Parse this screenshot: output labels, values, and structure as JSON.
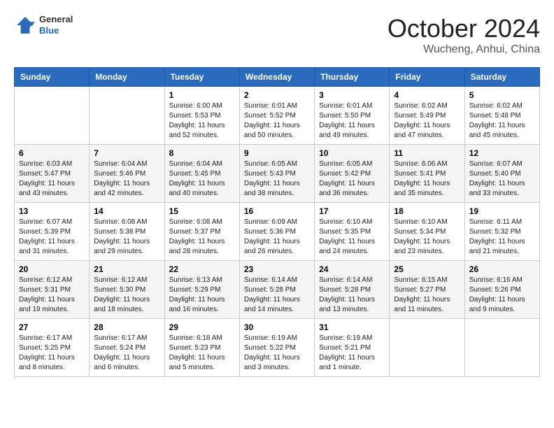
{
  "header": {
    "logo": {
      "general": "General",
      "blue": "Blue"
    },
    "title": "October 2024",
    "location": "Wucheng, Anhui, China"
  },
  "weekdays": [
    "Sunday",
    "Monday",
    "Tuesday",
    "Wednesday",
    "Thursday",
    "Friday",
    "Saturday"
  ],
  "weeks": [
    [
      {
        "day": "",
        "sunrise": "",
        "sunset": "",
        "daylight": ""
      },
      {
        "day": "",
        "sunrise": "",
        "sunset": "",
        "daylight": ""
      },
      {
        "day": "1",
        "sunrise": "Sunrise: 6:00 AM",
        "sunset": "Sunset: 5:53 PM",
        "daylight": "Daylight: 11 hours and 52 minutes."
      },
      {
        "day": "2",
        "sunrise": "Sunrise: 6:01 AM",
        "sunset": "Sunset: 5:52 PM",
        "daylight": "Daylight: 11 hours and 50 minutes."
      },
      {
        "day": "3",
        "sunrise": "Sunrise: 6:01 AM",
        "sunset": "Sunset: 5:50 PM",
        "daylight": "Daylight: 11 hours and 49 minutes."
      },
      {
        "day": "4",
        "sunrise": "Sunrise: 6:02 AM",
        "sunset": "Sunset: 5:49 PM",
        "daylight": "Daylight: 11 hours and 47 minutes."
      },
      {
        "day": "5",
        "sunrise": "Sunrise: 6:02 AM",
        "sunset": "Sunset: 5:48 PM",
        "daylight": "Daylight: 11 hours and 45 minutes."
      }
    ],
    [
      {
        "day": "6",
        "sunrise": "Sunrise: 6:03 AM",
        "sunset": "Sunset: 5:47 PM",
        "daylight": "Daylight: 11 hours and 43 minutes."
      },
      {
        "day": "7",
        "sunrise": "Sunrise: 6:04 AM",
        "sunset": "Sunset: 5:46 PM",
        "daylight": "Daylight: 11 hours and 42 minutes."
      },
      {
        "day": "8",
        "sunrise": "Sunrise: 6:04 AM",
        "sunset": "Sunset: 5:45 PM",
        "daylight": "Daylight: 11 hours and 40 minutes."
      },
      {
        "day": "9",
        "sunrise": "Sunrise: 6:05 AM",
        "sunset": "Sunset: 5:43 PM",
        "daylight": "Daylight: 11 hours and 38 minutes."
      },
      {
        "day": "10",
        "sunrise": "Sunrise: 6:05 AM",
        "sunset": "Sunset: 5:42 PM",
        "daylight": "Daylight: 11 hours and 36 minutes."
      },
      {
        "day": "11",
        "sunrise": "Sunrise: 6:06 AM",
        "sunset": "Sunset: 5:41 PM",
        "daylight": "Daylight: 11 hours and 35 minutes."
      },
      {
        "day": "12",
        "sunrise": "Sunrise: 6:07 AM",
        "sunset": "Sunset: 5:40 PM",
        "daylight": "Daylight: 11 hours and 33 minutes."
      }
    ],
    [
      {
        "day": "13",
        "sunrise": "Sunrise: 6:07 AM",
        "sunset": "Sunset: 5:39 PM",
        "daylight": "Daylight: 11 hours and 31 minutes."
      },
      {
        "day": "14",
        "sunrise": "Sunrise: 6:08 AM",
        "sunset": "Sunset: 5:38 PM",
        "daylight": "Daylight: 11 hours and 29 minutes."
      },
      {
        "day": "15",
        "sunrise": "Sunrise: 6:08 AM",
        "sunset": "Sunset: 5:37 PM",
        "daylight": "Daylight: 11 hours and 28 minutes."
      },
      {
        "day": "16",
        "sunrise": "Sunrise: 6:09 AM",
        "sunset": "Sunset: 5:36 PM",
        "daylight": "Daylight: 11 hours and 26 minutes."
      },
      {
        "day": "17",
        "sunrise": "Sunrise: 6:10 AM",
        "sunset": "Sunset: 5:35 PM",
        "daylight": "Daylight: 11 hours and 24 minutes."
      },
      {
        "day": "18",
        "sunrise": "Sunrise: 6:10 AM",
        "sunset": "Sunset: 5:34 PM",
        "daylight": "Daylight: 11 hours and 23 minutes."
      },
      {
        "day": "19",
        "sunrise": "Sunrise: 6:11 AM",
        "sunset": "Sunset: 5:32 PM",
        "daylight": "Daylight: 11 hours and 21 minutes."
      }
    ],
    [
      {
        "day": "20",
        "sunrise": "Sunrise: 6:12 AM",
        "sunset": "Sunset: 5:31 PM",
        "daylight": "Daylight: 11 hours and 19 minutes."
      },
      {
        "day": "21",
        "sunrise": "Sunrise: 6:12 AM",
        "sunset": "Sunset: 5:30 PM",
        "daylight": "Daylight: 11 hours and 18 minutes."
      },
      {
        "day": "22",
        "sunrise": "Sunrise: 6:13 AM",
        "sunset": "Sunset: 5:29 PM",
        "daylight": "Daylight: 11 hours and 16 minutes."
      },
      {
        "day": "23",
        "sunrise": "Sunrise: 6:14 AM",
        "sunset": "Sunset: 5:28 PM",
        "daylight": "Daylight: 11 hours and 14 minutes."
      },
      {
        "day": "24",
        "sunrise": "Sunrise: 6:14 AM",
        "sunset": "Sunset: 5:28 PM",
        "daylight": "Daylight: 11 hours and 13 minutes."
      },
      {
        "day": "25",
        "sunrise": "Sunrise: 6:15 AM",
        "sunset": "Sunset: 5:27 PM",
        "daylight": "Daylight: 11 hours and 11 minutes."
      },
      {
        "day": "26",
        "sunrise": "Sunrise: 6:16 AM",
        "sunset": "Sunset: 5:26 PM",
        "daylight": "Daylight: 11 hours and 9 minutes."
      }
    ],
    [
      {
        "day": "27",
        "sunrise": "Sunrise: 6:17 AM",
        "sunset": "Sunset: 5:25 PM",
        "daylight": "Daylight: 11 hours and 8 minutes."
      },
      {
        "day": "28",
        "sunrise": "Sunrise: 6:17 AM",
        "sunset": "Sunset: 5:24 PM",
        "daylight": "Daylight: 11 hours and 6 minutes."
      },
      {
        "day": "29",
        "sunrise": "Sunrise: 6:18 AM",
        "sunset": "Sunset: 5:23 PM",
        "daylight": "Daylight: 11 hours and 5 minutes."
      },
      {
        "day": "30",
        "sunrise": "Sunrise: 6:19 AM",
        "sunset": "Sunset: 5:22 PM",
        "daylight": "Daylight: 11 hours and 3 minutes."
      },
      {
        "day": "31",
        "sunrise": "Sunrise: 6:19 AM",
        "sunset": "Sunset: 5:21 PM",
        "daylight": "Daylight: 11 hours and 1 minute."
      },
      {
        "day": "",
        "sunrise": "",
        "sunset": "",
        "daylight": ""
      },
      {
        "day": "",
        "sunrise": "",
        "sunset": "",
        "daylight": ""
      }
    ]
  ]
}
